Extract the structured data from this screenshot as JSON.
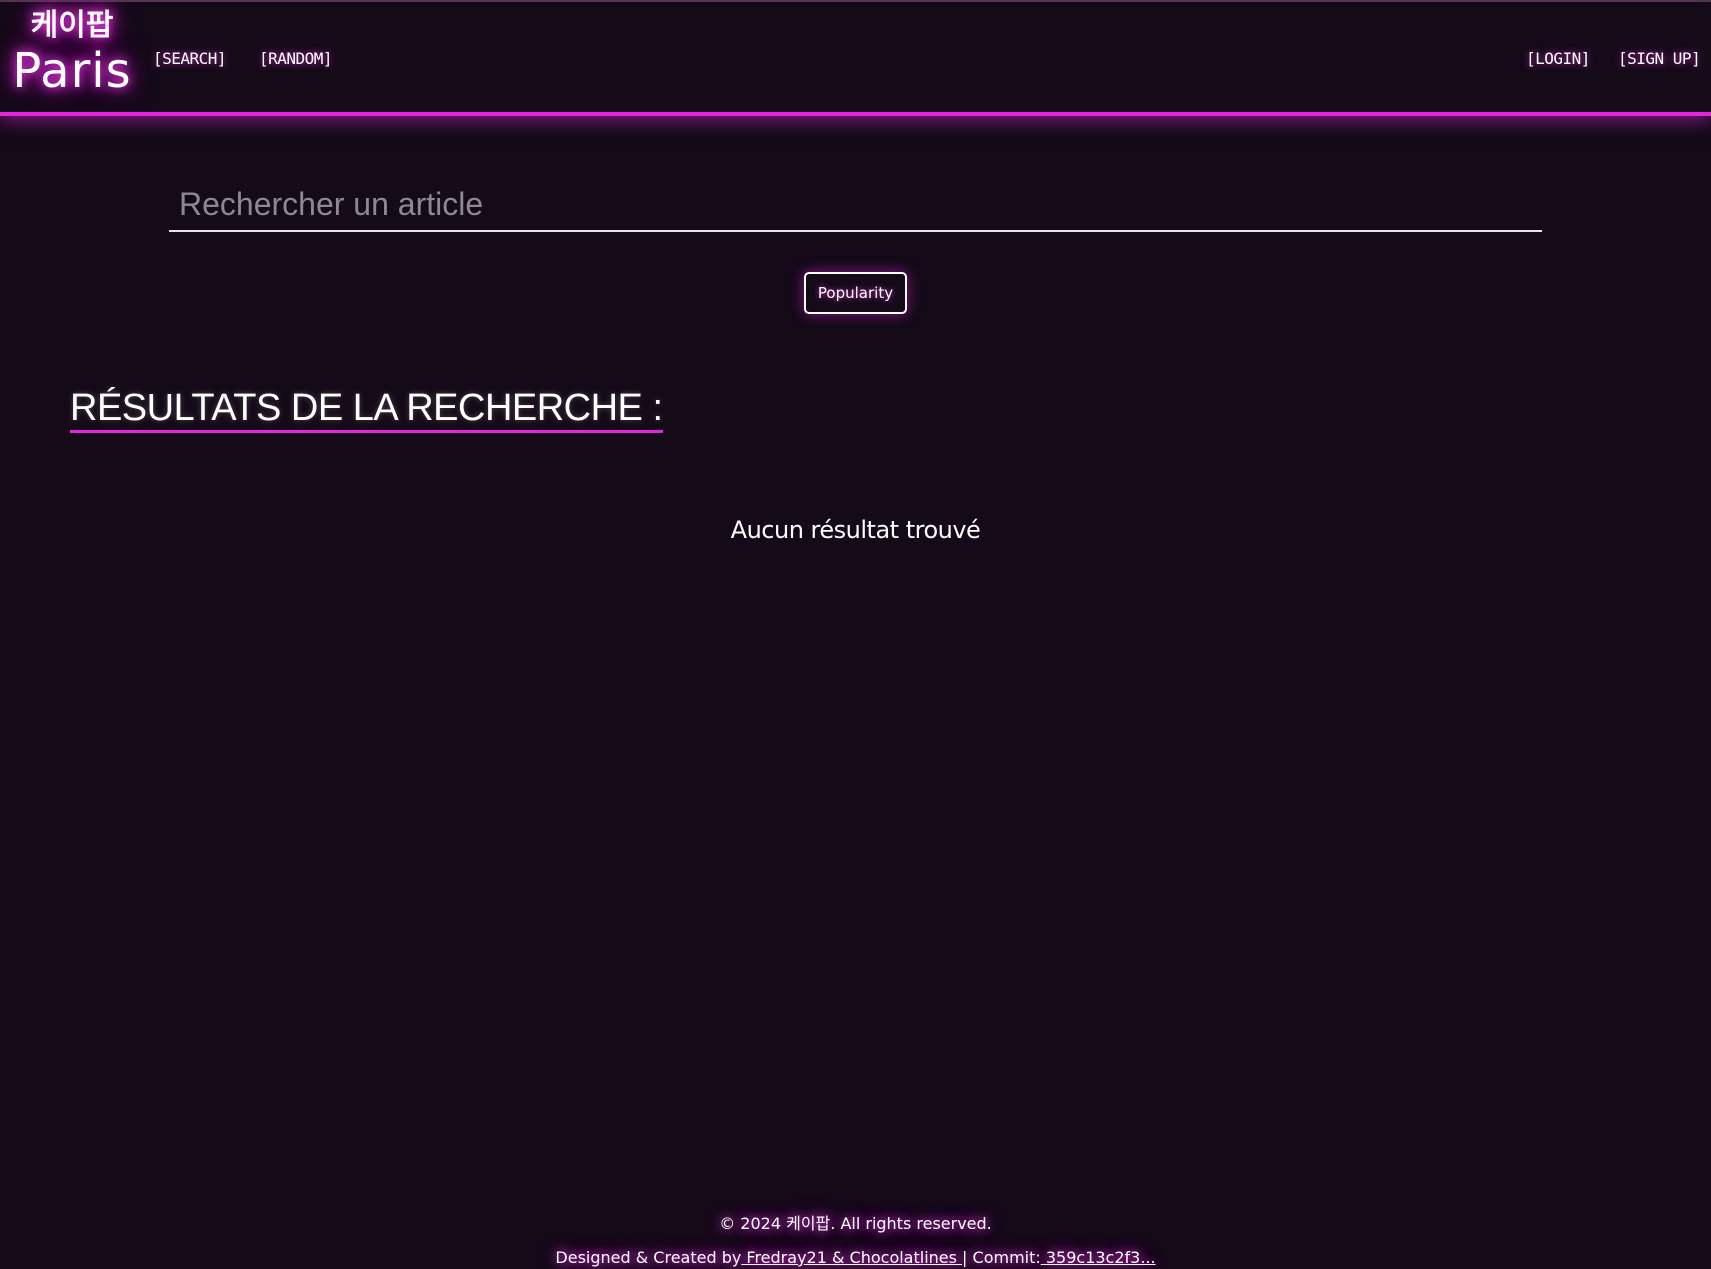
{
  "header": {
    "logo_korean": "케이팝",
    "logo_latin": "Paris",
    "nav_left": {
      "search": "[SEARCH]",
      "random": "[RANDOM]"
    },
    "nav_right": {
      "login": "[LOGIN]",
      "signup": "[SIGN UP]"
    }
  },
  "search": {
    "placeholder": "Rechercher un article",
    "value": ""
  },
  "sort": {
    "popularity_label": "Popularity"
  },
  "results": {
    "title": "RÉSULTATS DE LA RECHERCHE :",
    "empty_message": "Aucun résultat trouvé"
  },
  "footer": {
    "copyright": "© 2024 케이팝. All rights reserved.",
    "designed_prefix": "Designed & Created by",
    "authors_link": " Fredray21 & Chocolatlines ",
    "commit_separator": "| Commit:",
    "commit_link": " 359c13c2f3..."
  },
  "colors": {
    "background": "#140a18",
    "accent": "#e524e0",
    "text": "#ffffff",
    "placeholder": "#8d8a8f"
  }
}
